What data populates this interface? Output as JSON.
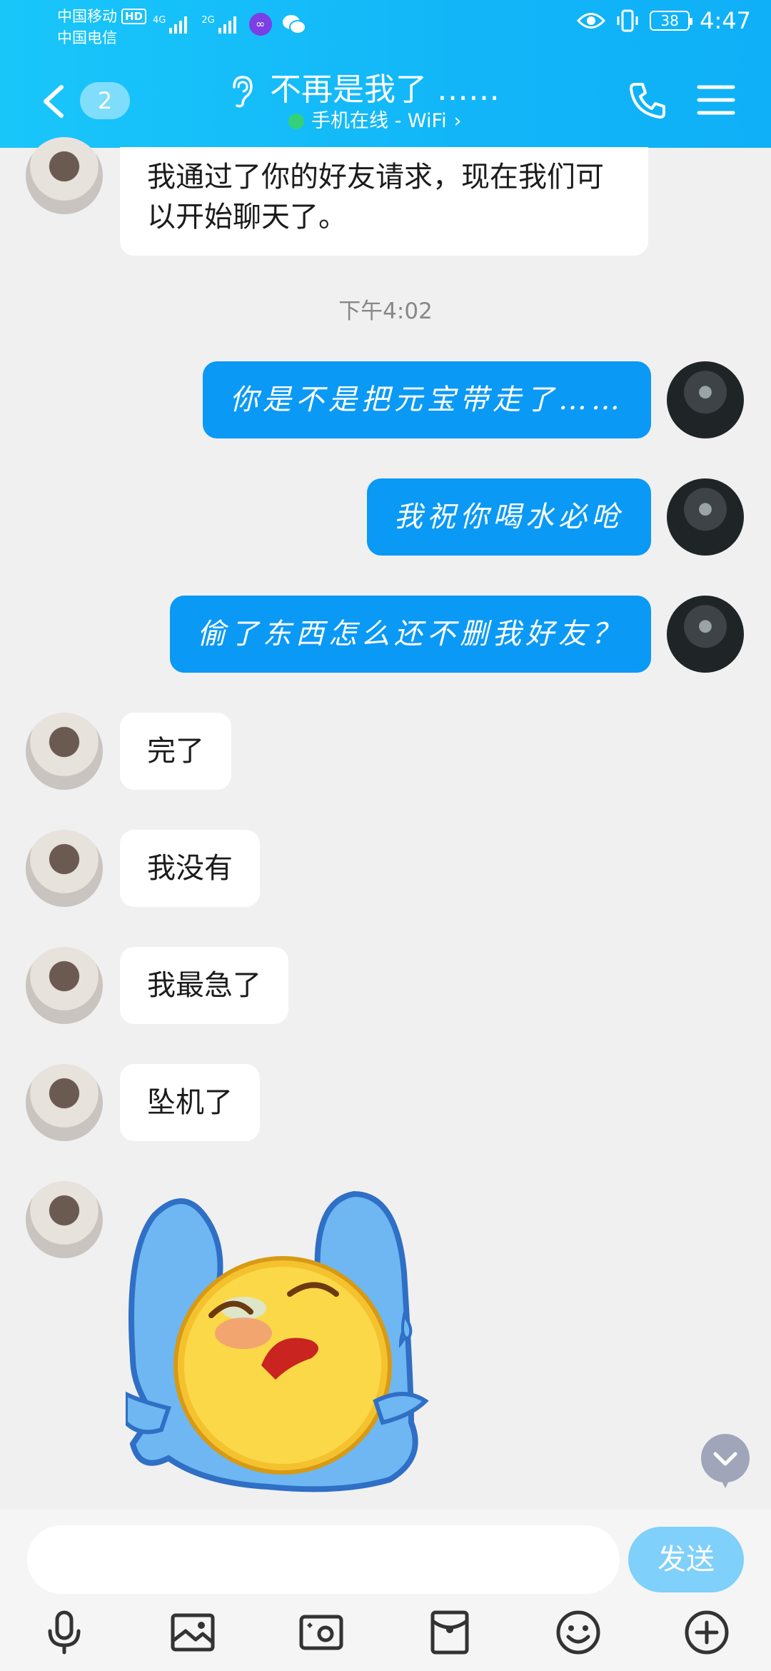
{
  "status_bar": {
    "carrier1": "中国移动",
    "carrier1_badge": "HD",
    "carrier2": "中国电信",
    "signal1_label": "4G",
    "signal2_label": "2G",
    "battery": "38",
    "time": "4:47"
  },
  "header": {
    "unread_count": "2",
    "title": "不再是我了 ……",
    "subtitle": "手机在线 - WiFi",
    "subtitle_chevron": "›"
  },
  "messages": {
    "first": "我通过了你的好友请求，现在我们可以开始聊天了。",
    "time_separator": "下午4:02",
    "out1": "你是不是把元宝带走了……",
    "out2": "我祝你喝水必呛",
    "out3": "偷了东西怎么还不删我好友？",
    "in1": "完了",
    "in2": "我没有",
    "in3": "我最急了",
    "in4": "坠机了"
  },
  "input_bar": {
    "placeholder": "",
    "send_label": "发送"
  },
  "colors": {
    "header": "#12b6f8",
    "bubble_out": "#0a99f5",
    "send_button": "#7fd0fa"
  },
  "icons": {
    "back": "chevron-left-icon",
    "ear": "ear-icon",
    "phone": "phone-icon",
    "menu": "menu-icon",
    "voice": "microphone-icon",
    "image": "image-icon",
    "camera": "camera-icon",
    "red_packet": "red-packet-icon",
    "emoji": "emoji-icon",
    "more": "plus-circle-icon",
    "scroll": "chevron-down-icon"
  }
}
